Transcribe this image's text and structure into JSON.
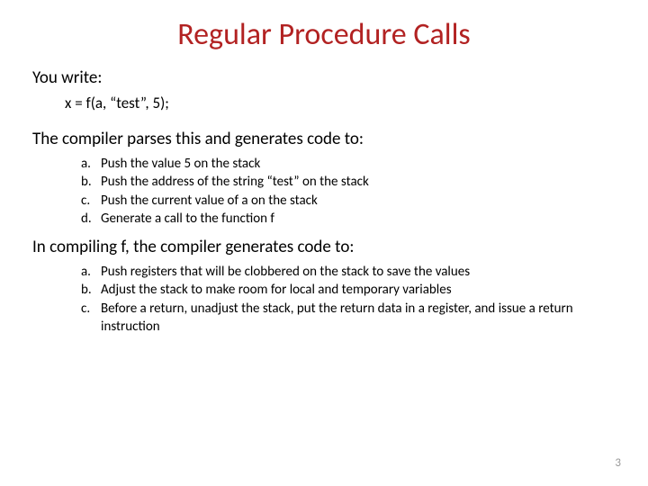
{
  "title": "Regular Procedure Calls",
  "section1": "You write:",
  "code": "x = f(a, “test”, 5);",
  "section2": "The compiler parses this and generates code to:",
  "list1": [
    {
      "marker": "a.",
      "text": "Push the value 5 on the stack"
    },
    {
      "marker": "b.",
      "text": "Push the address of the string “test” on the stack"
    },
    {
      "marker": "c.",
      "text": "Push the current value of a on the stack"
    },
    {
      "marker": "d.",
      "text": "Generate a call to the function f"
    }
  ],
  "section3": "In compiling f, the compiler generates code to:",
  "list2": [
    {
      "marker": "a.",
      "text": "Push registers that will be clobbered on the stack to save the values"
    },
    {
      "marker": "b.",
      "text": "Adjust the stack to make room for local and temporary variables"
    },
    {
      "marker": "c.",
      "text": "Before a return, unadjust the stack, put the return data in a register, and issue a return instruction"
    }
  ],
  "page_number": "3"
}
